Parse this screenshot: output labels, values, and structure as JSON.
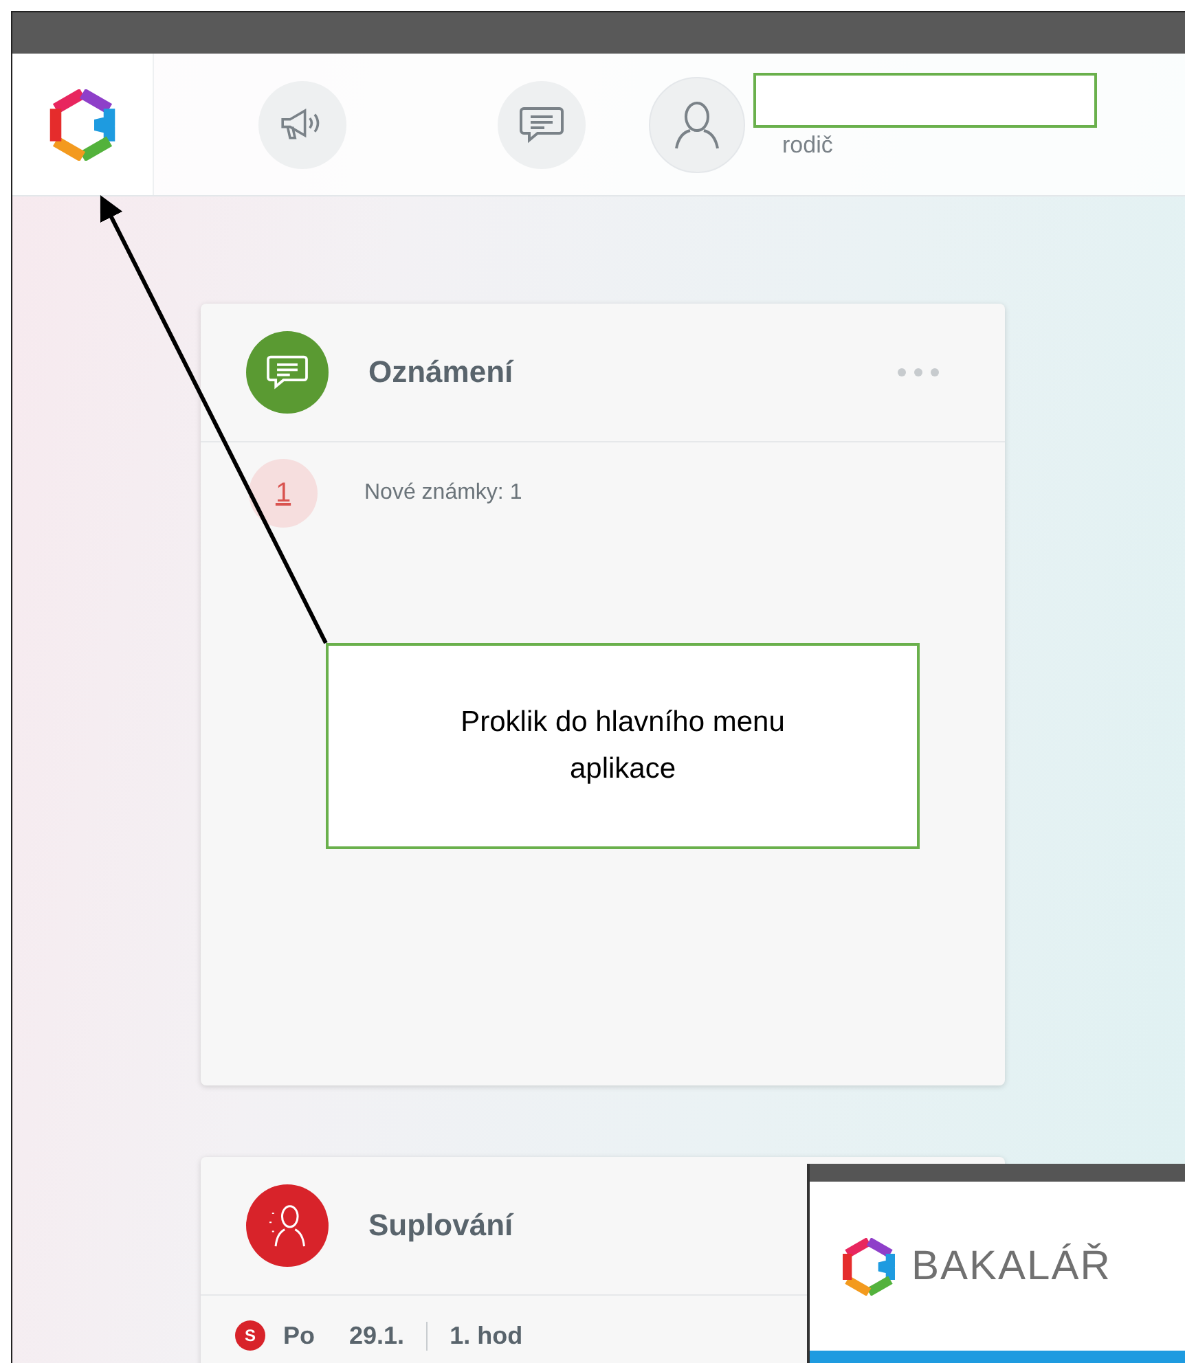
{
  "header": {
    "role": "rodič"
  },
  "announcements": {
    "title": "Oznámení",
    "items": [
      {
        "badge": "1",
        "text": "Nové známky: 1"
      }
    ]
  },
  "substitutions": {
    "title": "Suplování",
    "rows": [
      {
        "marker": "S",
        "day": "Po",
        "date": "29.1.",
        "lesson": "1. hod"
      }
    ]
  },
  "callout": {
    "text": "Proklik do hlavního menu aplikace"
  },
  "overlay_window": {
    "brand": "BAKALÁŘ"
  }
}
